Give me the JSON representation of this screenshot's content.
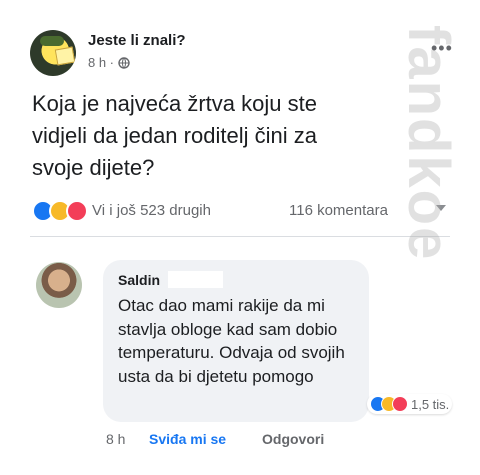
{
  "post": {
    "page_name": "Jeste li znali?",
    "time": "8 h ·",
    "text": "Koja je najveća žrtva koju ste vidjeli da jedan roditelj čini za svoje dijete?",
    "reactions_text": "Vi i još 523 drugih",
    "comments_count": "116 komentara",
    "more_label": "•••"
  },
  "comment": {
    "author": "Saldin",
    "text": "Otac dao mami rakije da mi stavlja obloge kad sam dobio temperaturu. Odvaja od svojih usta da bi djetetu pomogo",
    "reaction_count": "1,5 tis.",
    "time": "8 h",
    "like_label": "Sviđa mi se",
    "reply_label": "Odgovori"
  },
  "watermark": "fandkoe",
  "colors": {
    "like": "#1877f2",
    "haha": "#f7b928",
    "love": "#f33e58",
    "bubble": "#f0f2f5"
  },
  "icons": [
    "globe-icon",
    "like-reaction-icon",
    "haha-reaction-icon",
    "love-reaction-icon",
    "caret-down-icon",
    "more-options-icon"
  ]
}
